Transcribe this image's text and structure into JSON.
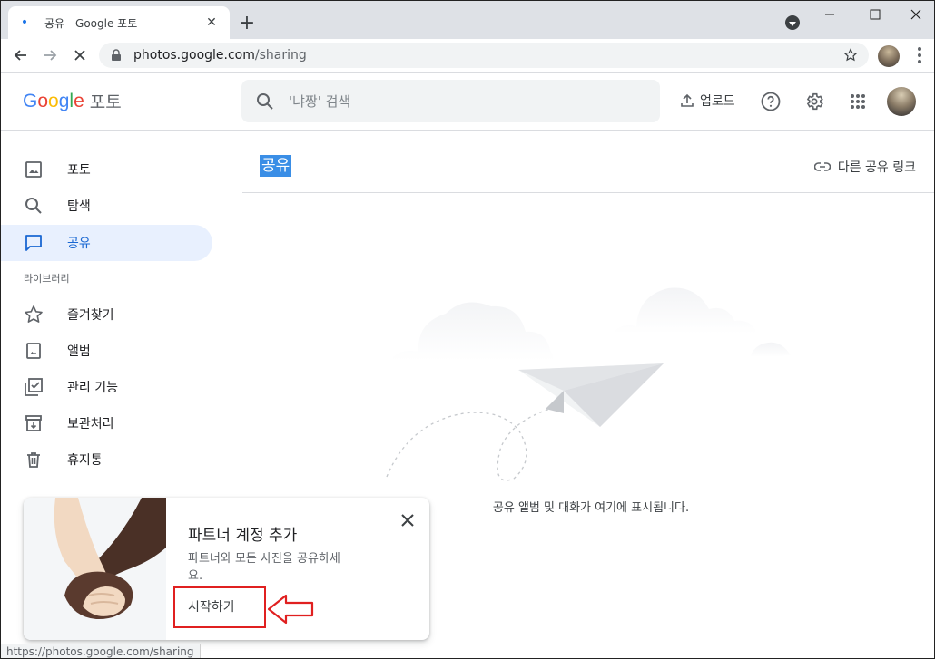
{
  "browser": {
    "tab_title": "공유 - Google 포토",
    "url_host": "photos.google.com",
    "url_path": "/sharing",
    "status_url": "https://photos.google.com/sharing"
  },
  "header": {
    "product_name": "포토",
    "search_placeholder": "'냐짱' 검색",
    "upload_label": "업로드"
  },
  "sidebar": {
    "items": [
      {
        "label": "포토",
        "icon": "photo-icon"
      },
      {
        "label": "탐색",
        "icon": "search-icon"
      },
      {
        "label": "공유",
        "icon": "sharing-icon",
        "active": true
      }
    ],
    "library_label": "라이브러리",
    "library_items": [
      {
        "label": "즐겨찾기",
        "icon": "star-icon"
      },
      {
        "label": "앨범",
        "icon": "album-icon"
      },
      {
        "label": "관리 기능",
        "icon": "utilities-icon"
      },
      {
        "label": "보관처리",
        "icon": "archive-icon"
      },
      {
        "label": "휴지통",
        "icon": "trash-icon"
      }
    ]
  },
  "main": {
    "title": "공유",
    "other_links_label": "다른 공유 링크",
    "empty_text": "공유 앨범 및 대화가 여기에 표시됩니다."
  },
  "promo": {
    "title": "파트너 계정 추가",
    "description": "파트너와 모든 사진을 공유하세요.",
    "action_label": "시작하기"
  },
  "colors": {
    "accent": "#1a73e8",
    "active_bg": "#e8f0fe",
    "annotation": "#e02020"
  }
}
